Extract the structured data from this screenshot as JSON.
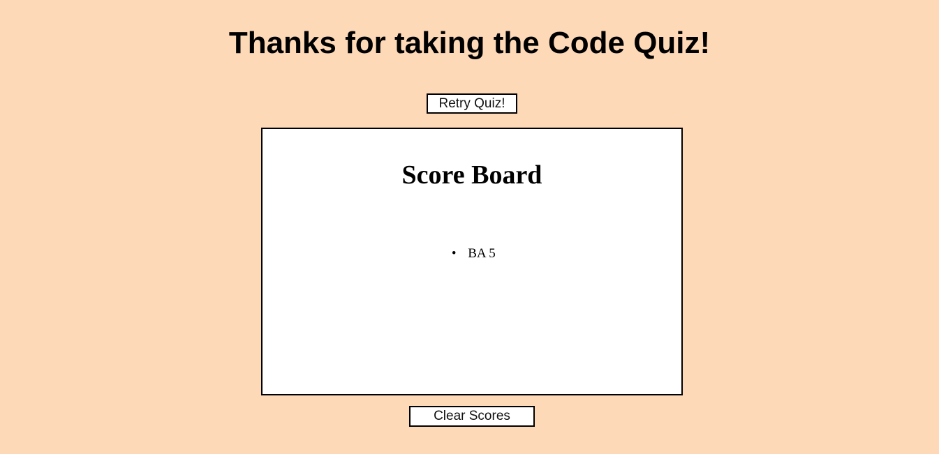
{
  "header": {
    "title": "Thanks for taking the Code Quiz!"
  },
  "actions": {
    "retry_label": "Retry Quiz!",
    "clear_label": "Clear Scores"
  },
  "scoreboard": {
    "title": "Score Board",
    "entries": [
      {
        "text": "BA 5"
      }
    ]
  },
  "colors": {
    "page_background": "#fed9b7",
    "panel_background": "#ffffff",
    "border": "#000000"
  }
}
